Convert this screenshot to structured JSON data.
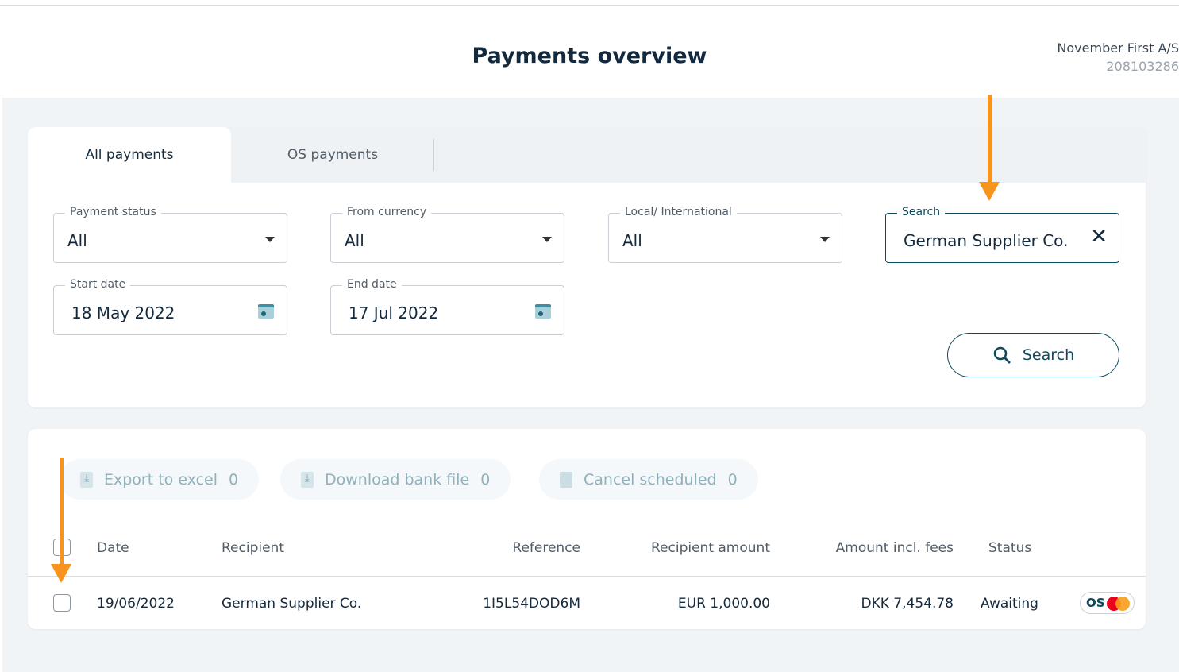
{
  "header": {
    "title": "Payments overview",
    "company": "November First A/S",
    "account_number": "208103286"
  },
  "tabs": [
    {
      "label": "All payments",
      "active": true
    },
    {
      "label": "OS payments",
      "active": false
    }
  ],
  "filters": {
    "payment_status": {
      "label": "Payment status",
      "value": "All"
    },
    "from_currency": {
      "label": "From currency",
      "value": "All"
    },
    "local_international": {
      "label": "Local/ International",
      "value": "All"
    },
    "search": {
      "label": "Search",
      "value": "German Supplier Co."
    },
    "start_date": {
      "label": "Start date",
      "value": "18 May 2022"
    },
    "end_date": {
      "label": "End date",
      "value": "17 Jul 2022"
    },
    "search_button": "Search"
  },
  "actions": [
    {
      "label": "Export to excel",
      "count": "0",
      "icon": "download-file-icon"
    },
    {
      "label": "Download bank file",
      "count": "0",
      "icon": "download-file-icon"
    },
    {
      "label": "Cancel scheduled",
      "count": "0",
      "icon": "trash-icon"
    }
  ],
  "table": {
    "columns": [
      "Date",
      "Recipient",
      "Reference",
      "Recipient amount",
      "Amount incl. fees",
      "Status"
    ],
    "rows": [
      {
        "date": "19/06/2022",
        "recipient": "German Supplier Co.",
        "reference": "1I5L54DOD6M",
        "recipient_amount": "EUR 1,000.00",
        "amount_incl_fees": "DKK 7,454.78",
        "status": "Awaiting",
        "badge": "OS"
      }
    ]
  },
  "colors": {
    "accent": "#0e4a5e",
    "annotation_arrow": "#f7941d",
    "background": "#f1f4f7"
  }
}
